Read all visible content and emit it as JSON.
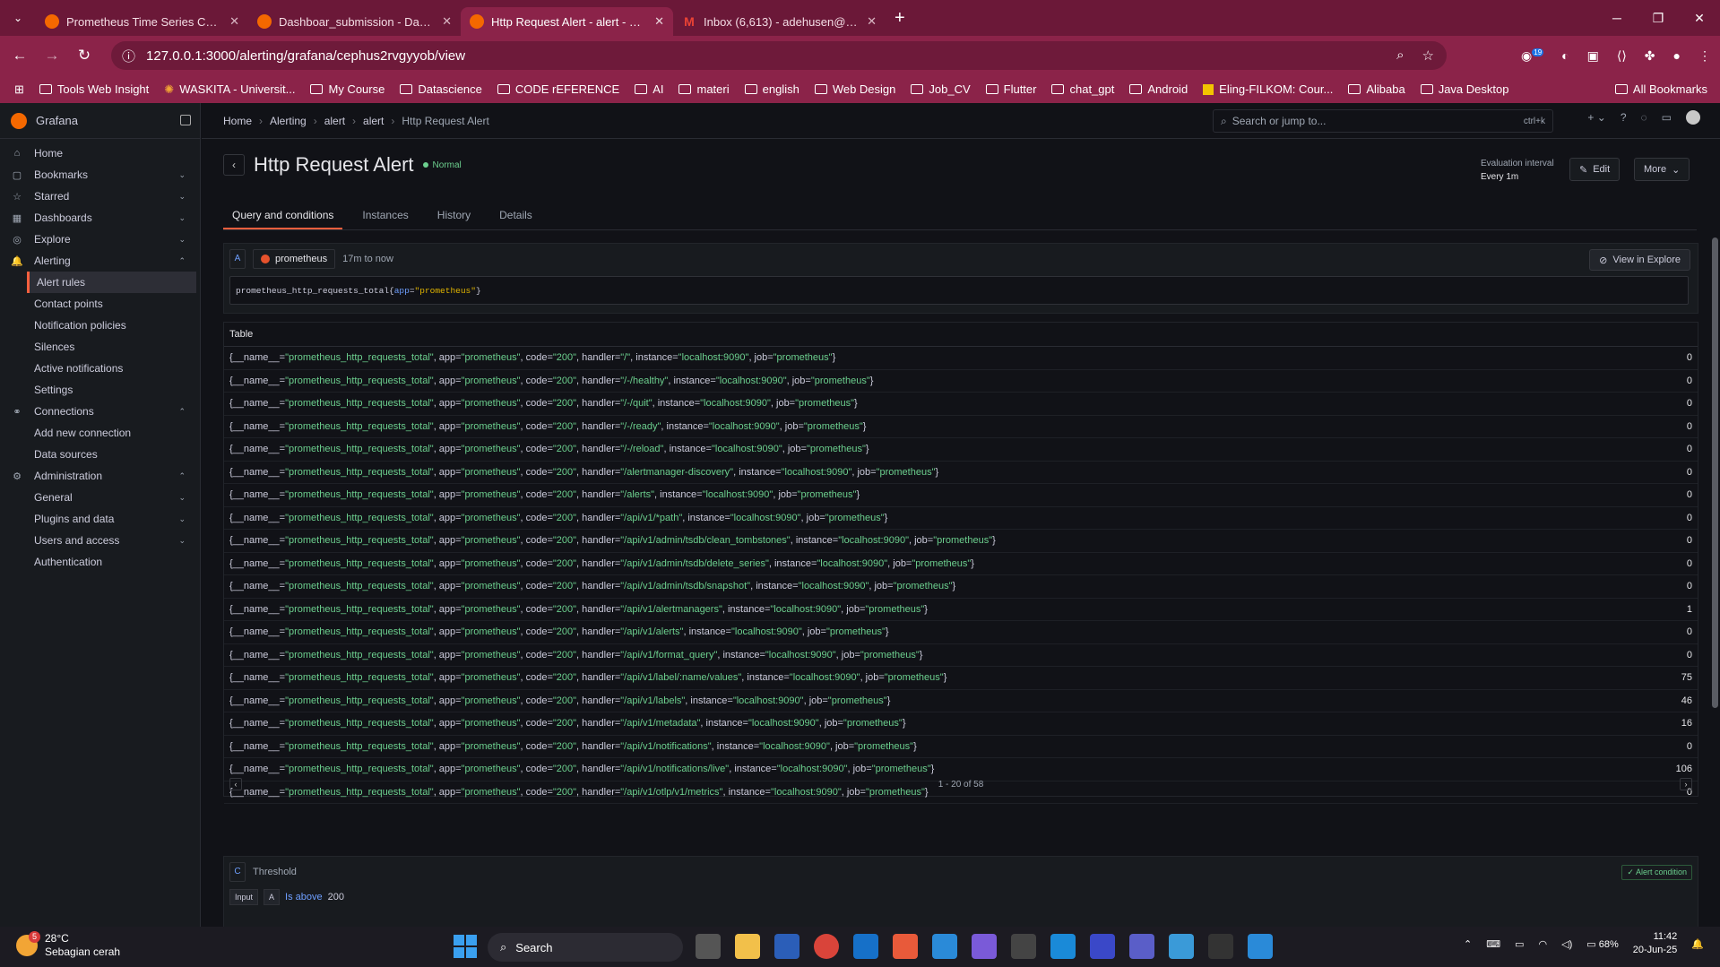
{
  "browser": {
    "tabs": [
      {
        "title": "Prometheus Time Series Collect",
        "icon": "grafana"
      },
      {
        "title": "Dashboar_submission - Dashbo",
        "icon": "grafana"
      },
      {
        "title": "Http Request Alert - alert - alert",
        "icon": "grafana"
      },
      {
        "title": "Inbox (6,613) - adehusen@gma",
        "icon": "gmail"
      }
    ],
    "url": "127.0.0.1:3000/alerting/grafana/cephus2rvgyyob/view",
    "bookmarks": [
      "Tools Web Insight",
      "WASKITA - Universit...",
      "My Course",
      "Datascience",
      "CODE rEFERENCE",
      "AI",
      "materi",
      "english",
      "Web Design",
      "Job_CV",
      "Flutter",
      "chat_gpt",
      "Android",
      "Eling-FILKOM: Cour...",
      "Alibaba",
      "Java Desktop"
    ],
    "all_bookmarks": "All Bookmarks",
    "ext_badge": "19"
  },
  "grafana": {
    "brand": "Grafana",
    "nav": [
      {
        "label": "Home",
        "icon": "⌂",
        "chev": ""
      },
      {
        "label": "Bookmarks",
        "icon": "▢",
        "chev": "⌄"
      },
      {
        "label": "Starred",
        "icon": "☆",
        "chev": "⌄"
      },
      {
        "label": "Dashboards",
        "icon": "▦",
        "chev": "⌄"
      },
      {
        "label": "Explore",
        "icon": "◎",
        "chev": "⌄"
      },
      {
        "label": "Alerting",
        "icon": "🔔",
        "chev": "⌃"
      },
      {
        "label": "Alert rules",
        "sub": true,
        "active": true
      },
      {
        "label": "Contact points",
        "sub": true
      },
      {
        "label": "Notification policies",
        "sub": true
      },
      {
        "label": "Silences",
        "sub": true
      },
      {
        "label": "Active notifications",
        "sub": true
      },
      {
        "label": "Settings",
        "sub": true
      },
      {
        "label": "Connections",
        "icon": "⚭",
        "chev": "⌃"
      },
      {
        "label": "Add new connection",
        "sub": true
      },
      {
        "label": "Data sources",
        "sub": true
      },
      {
        "label": "Administration",
        "icon": "⚙",
        "chev": "⌃"
      },
      {
        "label": "General",
        "sub": true,
        "chev": "⌄"
      },
      {
        "label": "Plugins and data",
        "sub": true,
        "chev": "⌄"
      },
      {
        "label": "Users and access",
        "sub": true,
        "chev": "⌄"
      },
      {
        "label": "Authentication",
        "sub": true
      }
    ],
    "breadcrumb": [
      "Home",
      "Alerting",
      "alert",
      "alert",
      "Http Request Alert"
    ],
    "search_placeholder": "Search or jump to...",
    "search_kbd": "ctrl+k",
    "title": "Http Request Alert",
    "state": "Normal",
    "eval_label": "Evaluation interval",
    "eval_value": "Every 1m",
    "edit": "Edit",
    "more": "More",
    "tabs": [
      "Query and conditions",
      "Instances",
      "History",
      "Details"
    ],
    "query": {
      "letter": "A",
      "datasource": "prometheus",
      "range": "17m to now",
      "explore": "View in Explore",
      "expr_metric": "prometheus_http_requests_total",
      "expr_label": "app",
      "expr_value": "\"prometheus\""
    },
    "table": {
      "title": "Table",
      "pagination": "1 - 20 of 58",
      "rows": [
        {
          "handler": "/",
          "value": "0"
        },
        {
          "handler": "/-/healthy",
          "value": "0"
        },
        {
          "handler": "/-/quit",
          "value": "0"
        },
        {
          "handler": "/-/ready",
          "value": "0"
        },
        {
          "handler": "/-/reload",
          "value": "0"
        },
        {
          "handler": "/alertmanager-discovery",
          "value": "0"
        },
        {
          "handler": "/alerts",
          "value": "0"
        },
        {
          "handler": "/api/v1/*path",
          "value": "0"
        },
        {
          "handler": "/api/v1/admin/tsdb/clean_tombstones",
          "value": "0"
        },
        {
          "handler": "/api/v1/admin/tsdb/delete_series",
          "value": "0"
        },
        {
          "handler": "/api/v1/admin/tsdb/snapshot",
          "value": "0"
        },
        {
          "handler": "/api/v1/alertmanagers",
          "value": "1"
        },
        {
          "handler": "/api/v1/alerts",
          "value": "0"
        },
        {
          "handler": "/api/v1/format_query",
          "value": "0"
        },
        {
          "handler": "/api/v1/label/:name/values",
          "value": "75"
        },
        {
          "handler": "/api/v1/labels",
          "value": "46"
        },
        {
          "handler": "/api/v1/metadata",
          "value": "16"
        },
        {
          "handler": "/api/v1/notifications",
          "value": "0"
        },
        {
          "handler": "/api/v1/notifications/live",
          "value": "106"
        },
        {
          "handler": "/api/v1/otlp/v1/metrics",
          "value": "0"
        }
      ]
    },
    "threshold": {
      "letter": "C",
      "label": "Threshold",
      "cond": "✓ Alert condition",
      "input": "Input",
      "ref": "A",
      "op": "Is above",
      "val": "200"
    }
  },
  "taskbar": {
    "temp": "28°C",
    "weather": "Sebagian cerah",
    "weather_badge": "5",
    "search": "Search",
    "battery": "68%",
    "time": "11:42",
    "date": "20-Jun-25",
    "notif_badge": "1"
  }
}
